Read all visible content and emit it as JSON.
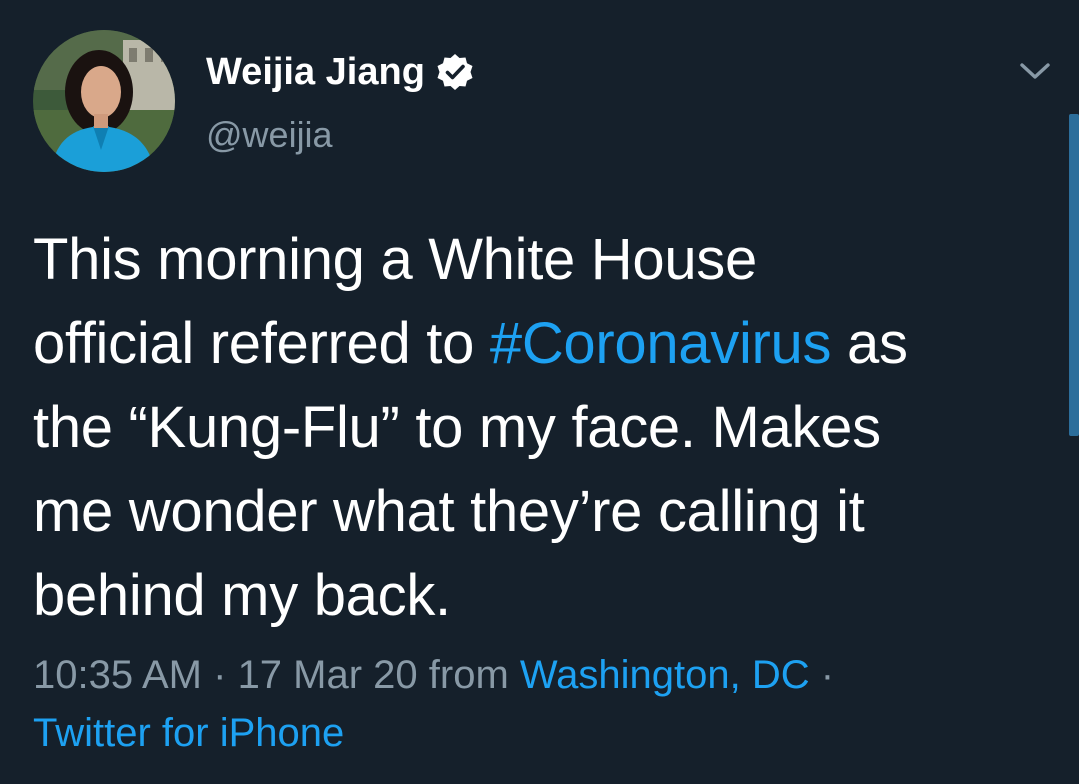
{
  "author": {
    "display_name": "Weijia Jiang",
    "handle": "@weijia",
    "verified": true
  },
  "tweet": {
    "line1": "This morning a White House",
    "line2_pre": "official referred to ",
    "hashtag": "#Coronavirus",
    "line2_post": " as",
    "line3": "the “Kung-Flu” to my face. Makes",
    "line4": "me wonder what they’re calling it",
    "line5": "behind my back."
  },
  "meta": {
    "time": "10:35 AM",
    "separator": " · ",
    "date": "17 Mar 20",
    "from_label": " from ",
    "location": "Washington, DC",
    "trailing_separator": " ·",
    "source": "Twitter for iPhone"
  },
  "icons": {
    "verified": "verified-badge-icon",
    "menu": "chevron-down-icon"
  },
  "colors": {
    "background": "#15202b",
    "text": "#ffffff",
    "secondary_text": "#8899a6",
    "accent": "#1da1f2"
  }
}
